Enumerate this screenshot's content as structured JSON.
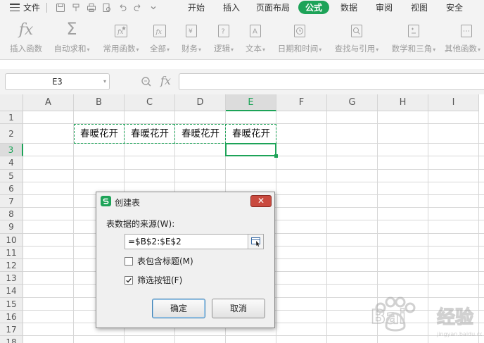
{
  "menubar": {
    "file_label": "文件",
    "tabs": [
      {
        "label": "开始",
        "active": false
      },
      {
        "label": "插入",
        "active": false
      },
      {
        "label": "页面布局",
        "active": false
      },
      {
        "label": "公式",
        "active": true
      },
      {
        "label": "数据",
        "active": false
      },
      {
        "label": "审阅",
        "active": false
      },
      {
        "label": "视图",
        "active": false
      },
      {
        "label": "安全",
        "active": false
      }
    ]
  },
  "ribbon": {
    "buttons": [
      {
        "label": "插入函数",
        "icon": "fx-icon"
      },
      {
        "label": "自动求和",
        "icon": "sigma-icon"
      },
      {
        "label": "常用函数",
        "icon": "star-function-icon"
      },
      {
        "label": "全部",
        "icon": "all-functions-icon"
      },
      {
        "label": "财务",
        "icon": "finance-icon"
      },
      {
        "label": "逻辑",
        "icon": "logic-icon"
      },
      {
        "label": "文本",
        "icon": "text-function-icon"
      },
      {
        "label": "日期和时间",
        "icon": "clock-icon"
      },
      {
        "label": "查找与引用",
        "icon": "lookup-icon"
      },
      {
        "label": "数学和三角",
        "icon": "math-icon"
      },
      {
        "label": "其他函数",
        "icon": "more-functions-icon"
      }
    ]
  },
  "formula_bar": {
    "name_box": "E3",
    "fx_label": "fx",
    "formula": ""
  },
  "sheet": {
    "columns": [
      "A",
      "B",
      "C",
      "D",
      "E",
      "F",
      "G",
      "H",
      "I"
    ],
    "selected_column": "E",
    "rows": [
      "1",
      "2",
      "3",
      "4",
      "5",
      "6",
      "7",
      "8",
      "9",
      "10",
      "11",
      "12",
      "13",
      "14",
      "15",
      "16",
      "17",
      "18"
    ],
    "selected_row": "3",
    "cells": {
      "B2": "春暖花开",
      "C2": "春暖花开",
      "D2": "春暖花开",
      "E2": "春暖花开"
    }
  },
  "dialog": {
    "title": "创建表",
    "close_label": "✕",
    "source_label": "表数据的来源(W):",
    "source_value": "=$B$2:$E$2",
    "has_header_label": "表包含标题(M)",
    "has_header_checked": false,
    "filter_label": "筛选按钮(F)",
    "filter_checked": true,
    "ok_label": "确定",
    "cancel_label": "取消"
  },
  "colors": {
    "accent": "#1da358",
    "close_button": "#c94a3f"
  }
}
